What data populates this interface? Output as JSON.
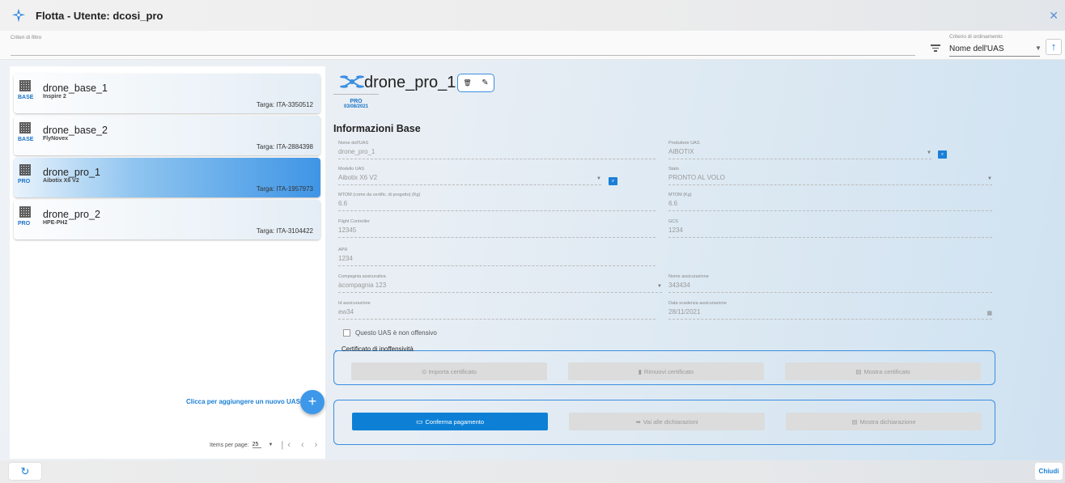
{
  "window": {
    "title": "Flotta - Utente: dcosi_pro",
    "close_glyph": "✕"
  },
  "filter": {
    "label": "Criteri di filtro",
    "value": ""
  },
  "sort": {
    "label": "Criterio di ordinamento",
    "value": "Nome dell'UAS",
    "direction_glyph": "↑"
  },
  "uas_list": [
    {
      "tier": "BASE",
      "name": "drone_base_1",
      "model": "Inspire 2",
      "plate": "Targa: ITA-3350512",
      "selected": false
    },
    {
      "tier": "BASE",
      "name": "drone_base_2",
      "model": "FlyNovex",
      "plate": "Targa: ITA-2884398",
      "selected": false
    },
    {
      "tier": "PRO",
      "name": "drone_pro_1",
      "model": "Aibotix X6 V2",
      "plate": "Targa: ITA-1957973",
      "selected": true
    },
    {
      "tier": "PRO",
      "name": "drone_pro_2",
      "model": "HPE-PH2",
      "plate": "Targa: ITA-3104422",
      "selected": false
    }
  ],
  "add_uas": {
    "text": "Clicca per aggiungere un nuovo UAS.",
    "glyph": "+"
  },
  "pagination": {
    "label": "Items per page:",
    "value": "25",
    "caret": "▼",
    "nav": "|‹ ‹ ›"
  },
  "detail": {
    "title": "drone_pro_1",
    "tier": "PRO",
    "date": "03/08/2021",
    "delete_glyph": "🗑",
    "edit_glyph": "✎",
    "section_title": "Informazioni Base",
    "fields": {
      "nome_uas": {
        "label": "Nome dell'UAS",
        "value": "drone_pro_1"
      },
      "produttore": {
        "label": "Produttore UAS",
        "value": "AIBOTIX"
      },
      "modello": {
        "label": "Modello UAS",
        "value": "Aibotix X6 V2"
      },
      "stato": {
        "label": "Stato",
        "value": "PRONTO AL VOLO"
      },
      "mtom_cert": {
        "label": "MTOM (come da certific. di progetto) (Kg)",
        "value": "6.6"
      },
      "mtom": {
        "label": "MTOM (Kg)",
        "value": "6.6"
      },
      "flight_controller": {
        "label": "Flight Controller",
        "value": "12345"
      },
      "gcs": {
        "label": "GCS",
        "value": "1234"
      },
      "apr": {
        "label": "APR",
        "value": "1234"
      },
      "compagnia": {
        "label": "Compagnia assicurativa",
        "value": "àcompagnia 123"
      },
      "nome_assicurazione": {
        "label": "Nome assicurazione",
        "value": "343434"
      },
      "id_assicurazione": {
        "label": "Id assicurazione",
        "value": "ew34"
      },
      "scadenza": {
        "label": "Data scadenza assicurazione",
        "value": "28/11/2021"
      }
    },
    "checkbox_label": "Questo UAS è non offensivo",
    "cert_legend": "Certificato di inoffensività",
    "cert_buttons": {
      "import": "Importa certificato",
      "remove": "Rimuovi certificato",
      "show": "Mostra certificato"
    },
    "pay_buttons": {
      "confirm": "Conferma pagamento",
      "declarations": "Vai alle dichiarazioni",
      "show_declaration": "Mostra dichiarazione"
    }
  },
  "footer": {
    "refresh_glyph": "↻",
    "close_label": "Chiudi"
  },
  "colors": {
    "accent": "#1a7fd6",
    "primary_button": "#0d80d6",
    "fieldset_border": "#3a8ee0"
  }
}
